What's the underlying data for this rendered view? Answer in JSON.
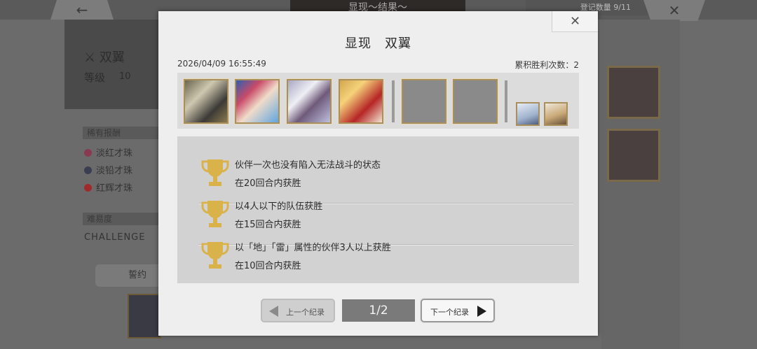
{
  "background": {
    "back_arrow": "←",
    "header_title": "显现～结果～",
    "record_count": "登记数量 9/11",
    "close_symbol": "✕",
    "boss_name": "双翼",
    "level_label": "等级",
    "level_value": "10",
    "rare_rewards_label": "稀有报酬",
    "rewards": [
      {
        "name": "淡红才珠",
        "color": "#8a3a50"
      },
      {
        "name": "淡铅才珠",
        "color": "#3a3e50"
      },
      {
        "name": "红辉才珠",
        "color": "#a02a2a"
      }
    ],
    "difficulty_label": "难易度",
    "difficulty_value": "CHALLENGE",
    "pledge_button": "誓约"
  },
  "dialog": {
    "title": "显现　双翼",
    "close_symbol": "✕",
    "date": "2026/04/09 16:55:49",
    "wins": "累积胜利次数：2",
    "party": [
      {
        "icon": "character-portrait-knight"
      },
      {
        "icon": "character-portrait-idol"
      },
      {
        "icon": "character-portrait-angel"
      },
      {
        "icon": "character-portrait-blonde"
      }
    ],
    "empty_slots": 2,
    "pets": [
      {
        "icon": "pet-icon-white-bird"
      },
      {
        "icon": "pet-icon-cat"
      }
    ],
    "objectives": [
      {
        "condition": "伙伴一次也没有陷入无法战斗的状态",
        "turns": "在20回合内获胜"
      },
      {
        "condition": "以4人以下的队伍获胜",
        "turns": "在15回合内获胜"
      },
      {
        "condition": "以「地」「雷」属性的伙伴3人以上获胜",
        "turns": "在10回合内获胜"
      }
    ],
    "prev_label": "上一个纪录",
    "next_label": "下一个纪录",
    "page_indicator": "1/2"
  },
  "colors": {
    "trophy": "#d9b24a",
    "frame_gold": "#a98f5c",
    "page_indicator_bg": "#7a7a7a"
  }
}
